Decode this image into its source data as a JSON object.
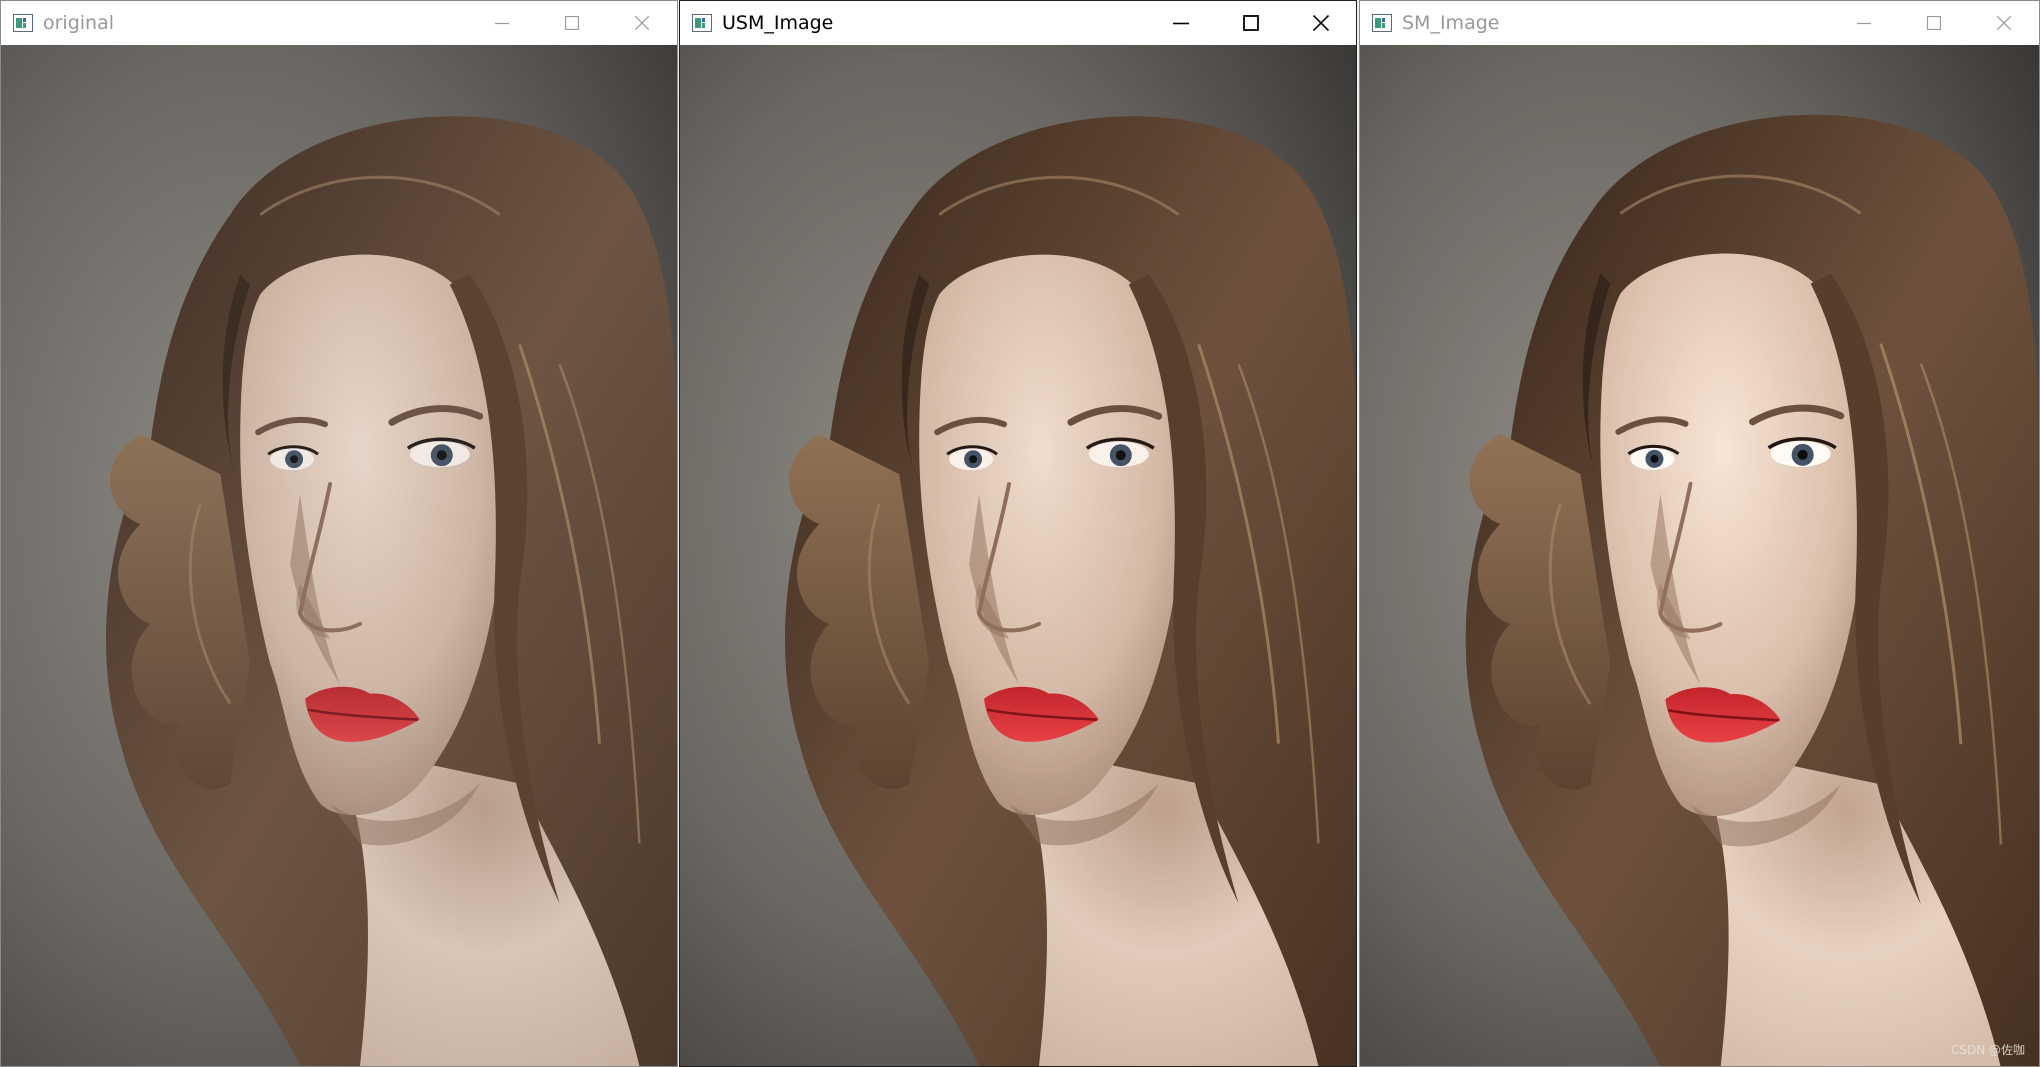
{
  "windows": [
    {
      "title": "original",
      "state": "inactive",
      "image": "portrait of woman with curly hair and red lips (original)"
    },
    {
      "title": "USM_Image",
      "state": "active",
      "image": "portrait of woman with curly hair and red lips (unsharp mask)"
    },
    {
      "title": "SM_Image",
      "state": "inactive",
      "image": "portrait of woman with curly hair and red lips (sharpened)"
    }
  ],
  "caption_icons": [
    "minimize-icon",
    "maximize-icon",
    "close-icon"
  ],
  "watermark": "CSDN @佐咖",
  "colors": {
    "titlebar": "#ffffff",
    "inactive_text": "#999999",
    "active_text": "#000000",
    "background_gray": "#6d6a66",
    "hair": "#5b4535",
    "skin": "#d9c3b3",
    "lips": "#c8383a"
  }
}
